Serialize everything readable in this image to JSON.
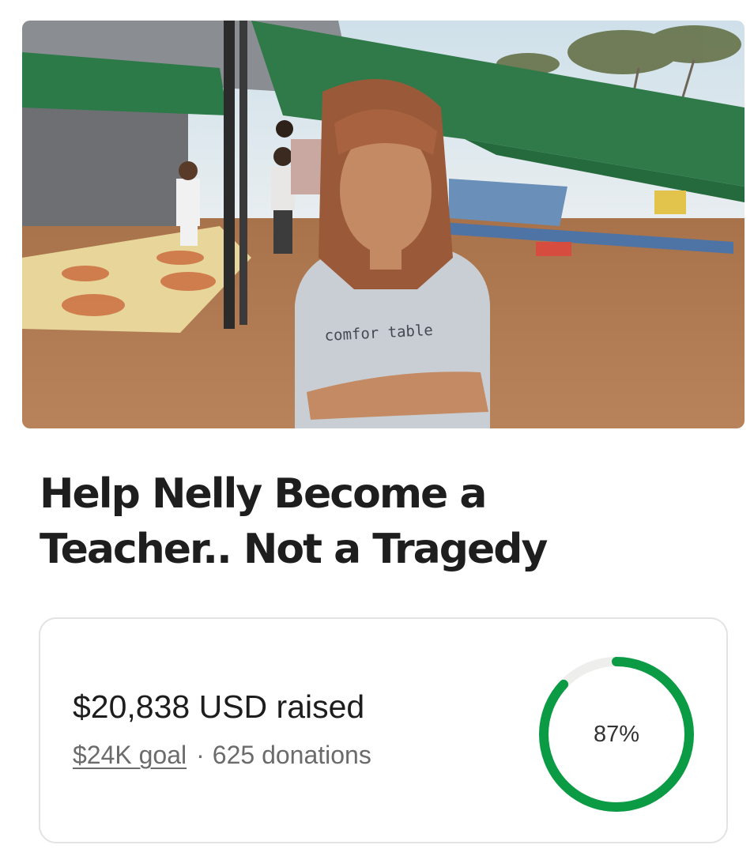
{
  "campaign": {
    "hero_photo_alt": "",
    "shirt_text": "comfor table",
    "title_line_1": "Help Nelly Become a",
    "title_line_2": "Teacher.. Not a Tragedy"
  },
  "progress_card": {
    "raised_text": "$20,838 USD raised",
    "goal_text": "$24K goal",
    "separator": "·",
    "donations_text": "625 donations",
    "percent_text": "87%",
    "percent_value": 0.87,
    "ring_color": "#0c9b45",
    "ring_track_color": "#eeeeec"
  }
}
